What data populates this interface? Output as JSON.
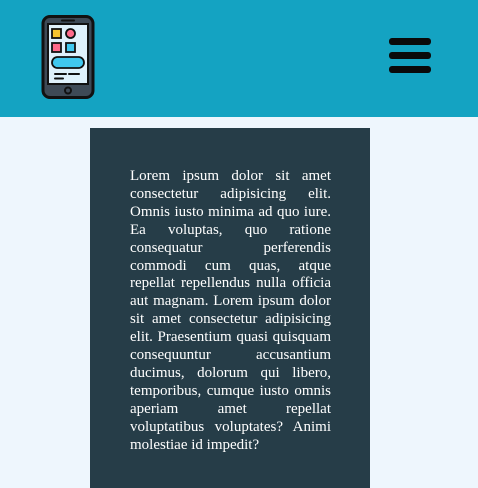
{
  "header": {
    "background": "#14a3c2",
    "logo_icon": "smartphone-apps-icon",
    "menu_icon": "hamburger-menu-icon"
  },
  "card": {
    "background": "#263d48",
    "text": "Lorem ipsum dolor sit amet consectetur adipisicing elit. Omnis iusto minima ad quo iure. Ea voluptas, quo ratione consequatur perferendis commodi cum quas, atque repellat repellendus nulla officia aut magnam. Lorem ipsum dolor sit amet consectetur adipisicing elit. Praesentium quasi quisquam consequuntur accusantium ducimus, dolorum qui libero, temporibus, cumque iusto omnis aperiam amet repellat voluptatibus voluptates? Animi molestiae id impedit?"
  }
}
